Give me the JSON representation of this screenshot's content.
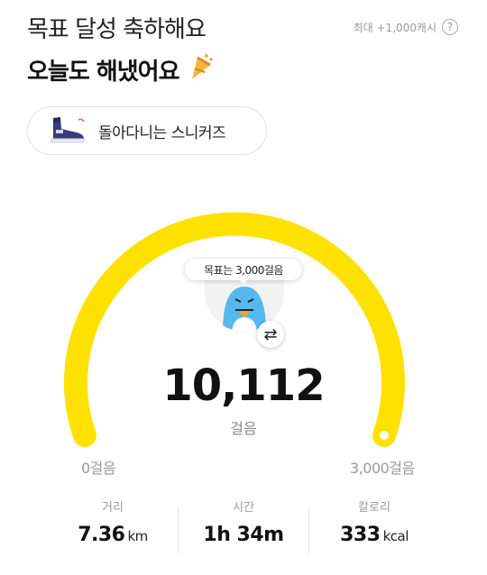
{
  "header": {
    "title_line1": "목표 달성 축하해요",
    "title_line2": "오늘도 해냈어요",
    "celebrate_icon": "party-popper-icon",
    "max_cash": "최대 +1,000캐시",
    "help_icon": "?"
  },
  "sneaker": {
    "label": "돌아다니는 스니커즈",
    "icon": "sneaker-icon"
  },
  "gauge": {
    "goal_text": "목표는 3,000걸음",
    "swap_icon": "⇄",
    "steps": "10,112",
    "steps_unit": "걸음",
    "min_label": "0걸음",
    "max_label": "3,000걸음",
    "progress": 1.0,
    "accent": "#FFE100"
  },
  "stats": {
    "distance": {
      "label": "거리",
      "value": "7.36",
      "unit": "km"
    },
    "time": {
      "label": "시간",
      "value": "1h 34m"
    },
    "calories": {
      "label": "칼로리",
      "value": "333",
      "unit": "kcal"
    }
  }
}
